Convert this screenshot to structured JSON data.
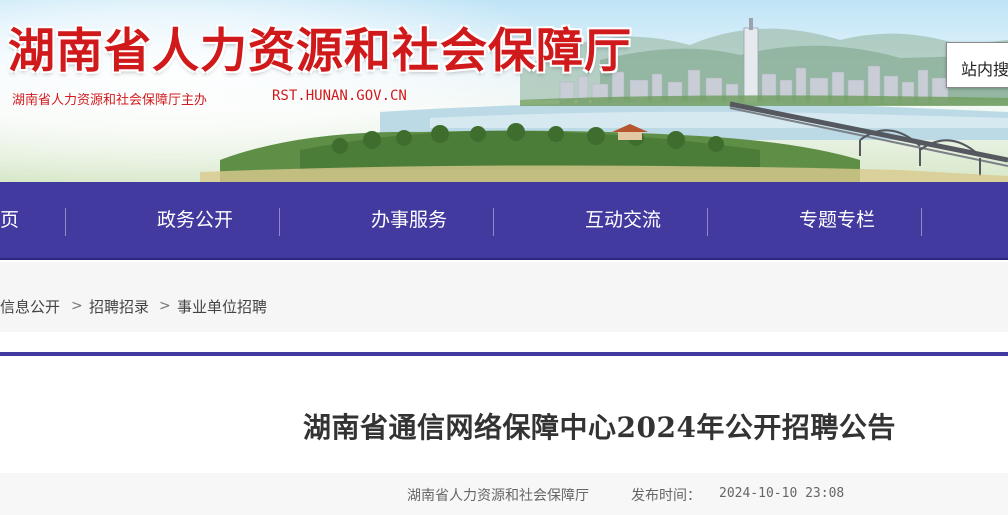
{
  "header": {
    "site_title": "湖南省人力资源和社会保障厅",
    "sponsor": "湖南省人力资源和社会保障厅主办",
    "domain": "RST.HUNAN.GOV.CN",
    "search_label": "站内搜"
  },
  "nav": {
    "items": [
      {
        "label": "页"
      },
      {
        "label": "政务公开"
      },
      {
        "label": "办事服务"
      },
      {
        "label": "互动交流"
      },
      {
        "label": "专题专栏"
      }
    ]
  },
  "breadcrumb": {
    "items": [
      {
        "label": "信息公开"
      },
      {
        "label": "招聘招录"
      },
      {
        "label": "事业单位招聘"
      }
    ],
    "separator": ">"
  },
  "article": {
    "title": "湖南省通信网络保障中心2024年公开招聘公告",
    "source": "湖南省人力资源和社会保障厅",
    "publish_label": "发布时间：",
    "publish_date": "2024-10-10 23:08"
  },
  "colors": {
    "nav_bg": "#433aa0",
    "title_red": "#d0191b"
  }
}
